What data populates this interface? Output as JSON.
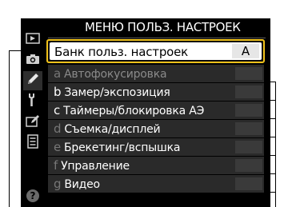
{
  "header": {
    "title": "МЕНЮ ПОЛЬЗ. НАСТРОЕК"
  },
  "sidebar": {
    "tabs": [
      {
        "icon": "playback-icon"
      },
      {
        "icon": "camera-icon"
      },
      {
        "icon": "pencil-icon",
        "active": true
      },
      {
        "icon": "wrench-icon"
      },
      {
        "icon": "retouch-icon"
      },
      {
        "icon": "my-menu-icon"
      },
      {
        "icon": "help-icon",
        "glyph": "?"
      }
    ]
  },
  "bank": {
    "label": "Банк польз. настроек",
    "value": "A"
  },
  "menu": {
    "items": [
      {
        "letter": "a",
        "label": "Автофокусировка"
      },
      {
        "letter": "b",
        "label": "Замер/экспозиция"
      },
      {
        "letter": "c",
        "label": "Таймеры/блокировка АЭ"
      },
      {
        "letter": "d",
        "label": "Съемка/дисплей"
      },
      {
        "letter": "e",
        "label": "Брекетинг/вспышка"
      },
      {
        "letter": "f",
        "label": "Управление"
      },
      {
        "letter": "g",
        "label": "Видео"
      }
    ]
  },
  "colors": {
    "highlight_border": "#f1c21b",
    "screen_bg": "#000000",
    "row_bg": "#2a2a2a"
  }
}
